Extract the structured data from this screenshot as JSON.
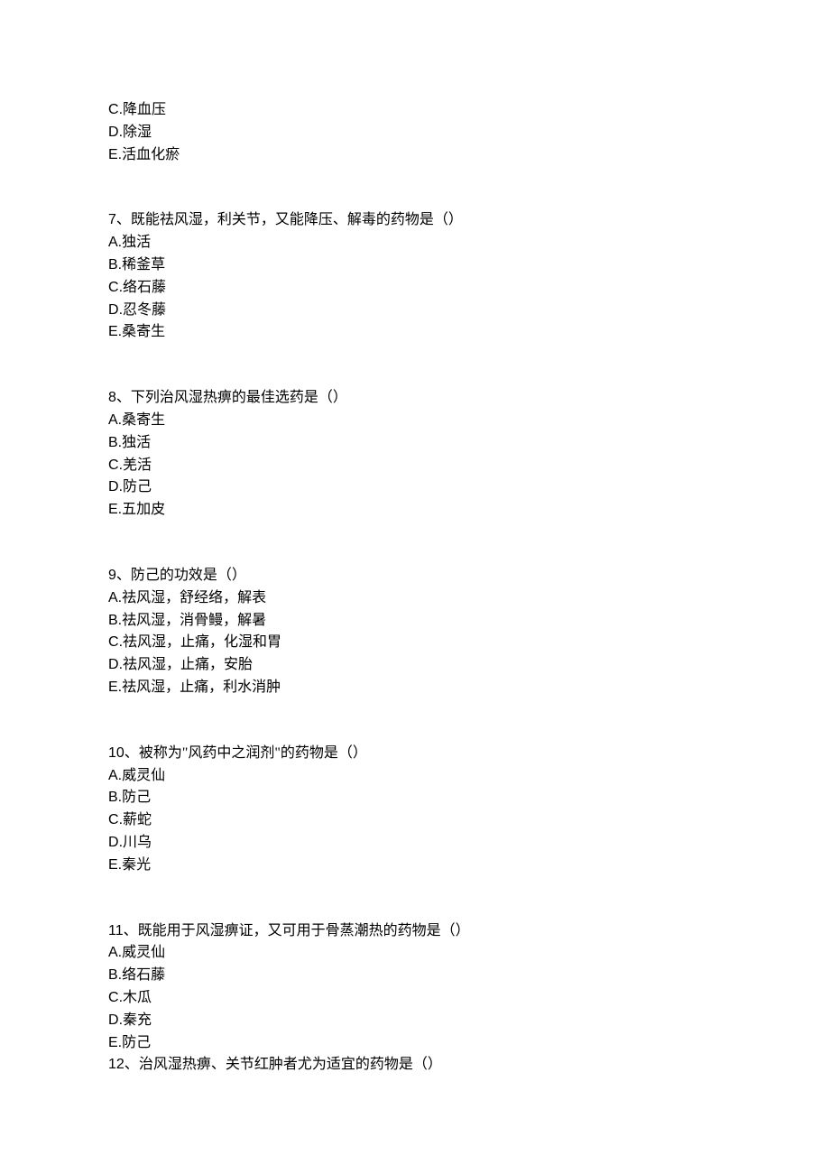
{
  "q6_tail": {
    "options": [
      {
        "letter": "C",
        "text": "降血压"
      },
      {
        "letter": "D",
        "text": "除湿"
      },
      {
        "letter": "E",
        "text": "活血化瘀"
      }
    ]
  },
  "questions": [
    {
      "number": "7",
      "stem": "既能祛风湿，利关节，又能降压、解毒的药物是（）",
      "options": [
        {
          "letter": "A",
          "text": "独活"
        },
        {
          "letter": "B",
          "text": "稀釜草"
        },
        {
          "letter": "C",
          "text": "络石藤"
        },
        {
          "letter": "D",
          "text": "忍冬藤"
        },
        {
          "letter": "E",
          "text": "桑寄生"
        }
      ]
    },
    {
      "number": "8",
      "stem": "下列治风湿热痹的最佳选药是（）",
      "options": [
        {
          "letter": "A",
          "text": "桑寄生"
        },
        {
          "letter": "B",
          "text": "独活"
        },
        {
          "letter": "C",
          "text": "羌活"
        },
        {
          "letter": "D",
          "text": "防己"
        },
        {
          "letter": "E",
          "text": "五加皮"
        }
      ]
    },
    {
      "number": "9",
      "stem": "防己的功效是（）",
      "options": [
        {
          "letter": "A",
          "text": "祛风湿，舒经络，解表"
        },
        {
          "letter": "B",
          "text": "祛风湿，消骨鳗，解暑"
        },
        {
          "letter": "C",
          "text": "祛风湿，止痛，化湿和胃"
        },
        {
          "letter": "D",
          "text": "祛风湿，止痛，安胎"
        },
        {
          "letter": "E",
          "text": "祛风湿，止痛，利水消肿"
        }
      ]
    },
    {
      "number": "10",
      "stem": "被称为\"风药中之润剂\"的药物是（）",
      "options": [
        {
          "letter": "A",
          "text": "威灵仙"
        },
        {
          "letter": "B",
          "text": "防己"
        },
        {
          "letter": "C",
          "text": "薪蛇"
        },
        {
          "letter": "D",
          "text": "川乌"
        },
        {
          "letter": "E",
          "text": "秦光"
        }
      ]
    },
    {
      "number": "11",
      "stem": "既能用于风湿痹证，又可用于骨蒸潮热的药物是（）",
      "options": [
        {
          "letter": "A",
          "text": "威灵仙"
        },
        {
          "letter": "B",
          "text": "络石藤"
        },
        {
          "letter": "C",
          "text": "木瓜"
        },
        {
          "letter": "D",
          "text": "秦充"
        },
        {
          "letter": "E",
          "text": "防己"
        }
      ]
    }
  ],
  "q12": {
    "number": "12",
    "stem": "治风湿热痹、关节红肿者尤为适宜的药物是（）"
  },
  "sep": "、",
  "dot": "."
}
